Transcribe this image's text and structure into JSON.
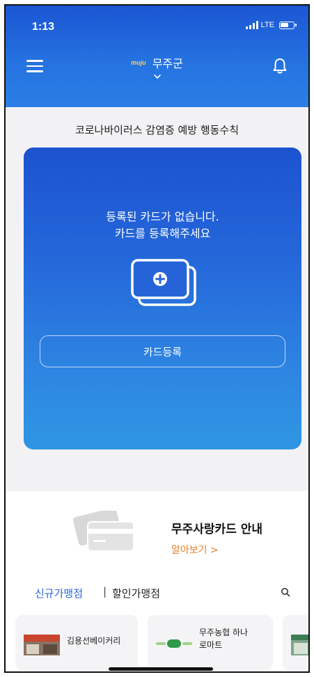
{
  "status_bar": {
    "time": "1:13",
    "network": "LTE"
  },
  "header": {
    "brand_logo": "muju",
    "region": "무주군",
    "accent": "#1b56d3"
  },
  "notice": {
    "text": "코로나바이러스 감염증 예방 행동수칙"
  },
  "card": {
    "empty_line1": "등록된 카드가 없습니다.",
    "empty_line2": "카드를 등록해주세요",
    "add_icon": "add-card-icon",
    "register_button": "카드등록"
  },
  "promo": {
    "title": "무주사랑카드 안내",
    "link": "알아보기 >",
    "link_color": "#e67e22"
  },
  "tabs": {
    "new_stores": "신규가맹점",
    "separator": "|",
    "discount_stores": "할인가맹점"
  },
  "stores": [
    {
      "name": "김용선베이커리"
    },
    {
      "name": "무주농협 하나로마트"
    }
  ]
}
